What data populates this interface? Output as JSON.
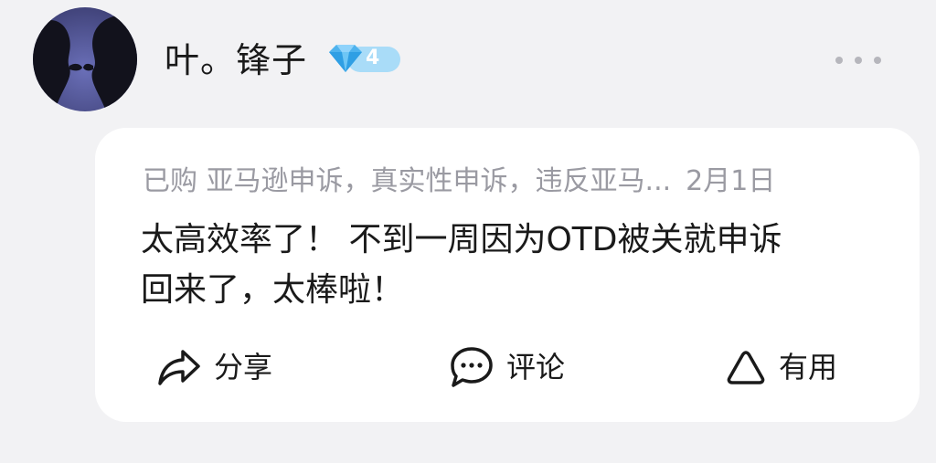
{
  "user": {
    "name": "叶。锋子",
    "level": "4",
    "avatar_icon": "couple-silhouette-avatar",
    "badge_icon": "diamond-icon",
    "badge_color": "#6ec6f5"
  },
  "review": {
    "purchase_tag": "已购",
    "product": "亚马逊申诉，真实性申诉，违反亚马...",
    "date": "2月1日",
    "text_line1": "太高效率了！ 不到一周因为OTD被关就申诉",
    "text_line2": "回来了，太棒啦！"
  },
  "actions": {
    "share_label": "分享",
    "share_icon": "share-arrow-icon",
    "comment_label": "评论",
    "comment_icon": "comment-bubble-icon",
    "useful_label": "有用",
    "useful_icon": "triangle-icon"
  },
  "colors": {
    "background": "#f2f2f4",
    "card": "#ffffff",
    "meta_text": "#9a9aa2",
    "main_text": "#1a1a1a"
  }
}
